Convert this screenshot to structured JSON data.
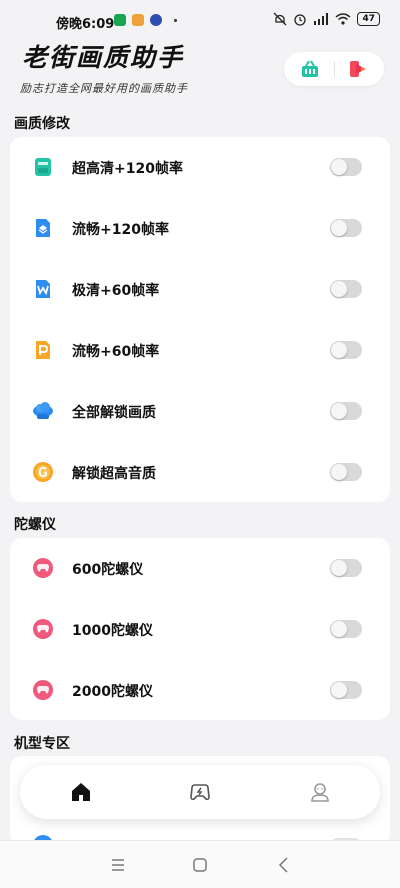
{
  "status_bar": {
    "time": "傍晚6:09",
    "battery": "47"
  },
  "header": {
    "title": "老街画质助手",
    "subtitle": "励志打造全网最好用的画质助手"
  },
  "colors": {
    "teal": "#23c4a6",
    "blue": "#2f8cf0",
    "orange": "#f8a623",
    "pink": "#ef5a7c",
    "red": "#f24a5c"
  },
  "sections": {
    "quality": {
      "title": "画质修改",
      "items": [
        {
          "label": "超高清+120帧率",
          "icon": "teal-chip-icon",
          "on": false
        },
        {
          "label": "流畅+120帧率",
          "icon": "blue-doc-icon",
          "on": false
        },
        {
          "label": "极清+60帧率",
          "icon": "word-doc-icon",
          "on": false
        },
        {
          "label": "流畅+60帧率",
          "icon": "ppt-doc-icon",
          "on": false
        },
        {
          "label": "全部解锁画质",
          "icon": "cloud-icon",
          "on": false
        },
        {
          "label": "解锁超高音质",
          "icon": "g-coin-icon",
          "on": false
        }
      ]
    },
    "gyro": {
      "title": "陀螺仪",
      "items": [
        {
          "label": "600陀螺仪",
          "icon": "pink-gamepad-icon",
          "on": false
        },
        {
          "label": "1000陀螺仪",
          "icon": "pink-gamepad-icon",
          "on": false
        },
        {
          "label": "2000陀螺仪",
          "icon": "pink-gamepad-icon",
          "on": false
        }
      ]
    },
    "model": {
      "title": "机型专区"
    }
  },
  "bottom_nav": [
    "home-icon",
    "game-icon",
    "profile-icon"
  ]
}
